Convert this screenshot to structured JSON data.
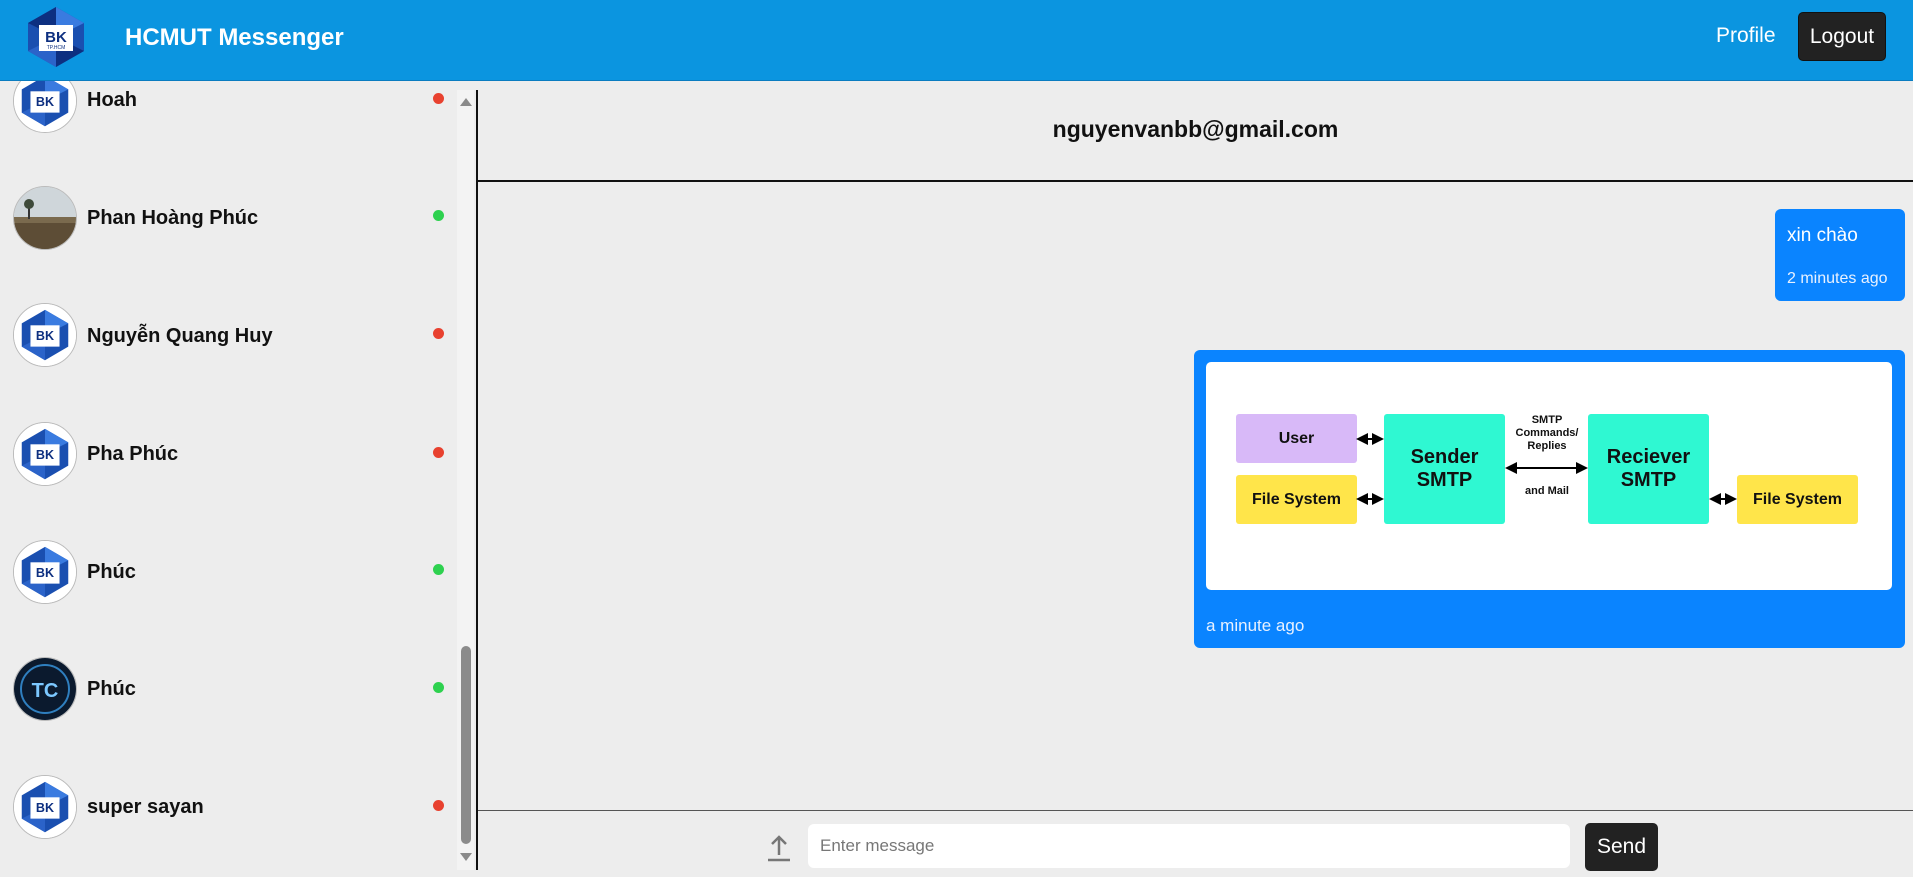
{
  "header": {
    "app_title": "HCMUT Messenger",
    "profile_label": "Profile",
    "logout_label": "Logout",
    "logo_text": "BK",
    "logo_subtext": "TP.HCM"
  },
  "colors": {
    "header_bg": "#0b95e0",
    "bubble_bg": "#0a84ff",
    "online": "#2ed14f",
    "offline": "#e8412f"
  },
  "contacts": [
    {
      "name": "Hoah",
      "status": "offline",
      "avatar": "bk-logo"
    },
    {
      "name": "Phan Hoàng Phúc",
      "status": "online",
      "avatar": "landscape-photo"
    },
    {
      "name": "Nguyễn Quang Huy",
      "status": "offline",
      "avatar": "bk-logo"
    },
    {
      "name": "Pha Phúc",
      "status": "offline",
      "avatar": "bk-logo"
    },
    {
      "name": "Phúc",
      "status": "online",
      "avatar": "bk-logo"
    },
    {
      "name": "Phúc",
      "status": "online",
      "avatar": "tcp-glow-photo"
    },
    {
      "name": "super sayan",
      "status": "offline",
      "avatar": "bk-logo"
    }
  ],
  "chat": {
    "recipient": "nguyenvanbb@gmail.com",
    "messages": [
      {
        "text": "xin chào",
        "time": "2 minutes ago"
      },
      {
        "type": "image",
        "time": "a minute ago"
      }
    ]
  },
  "diagram": {
    "user": "User",
    "file_system_left": "File System",
    "sender": "Sender SMTP",
    "receiver": "Reciever SMTP",
    "file_system_right": "File System",
    "commands": "SMTP Commands/ Replies",
    "mail": "and Mail"
  },
  "composer": {
    "placeholder": "Enter message",
    "send_label": "Send"
  }
}
